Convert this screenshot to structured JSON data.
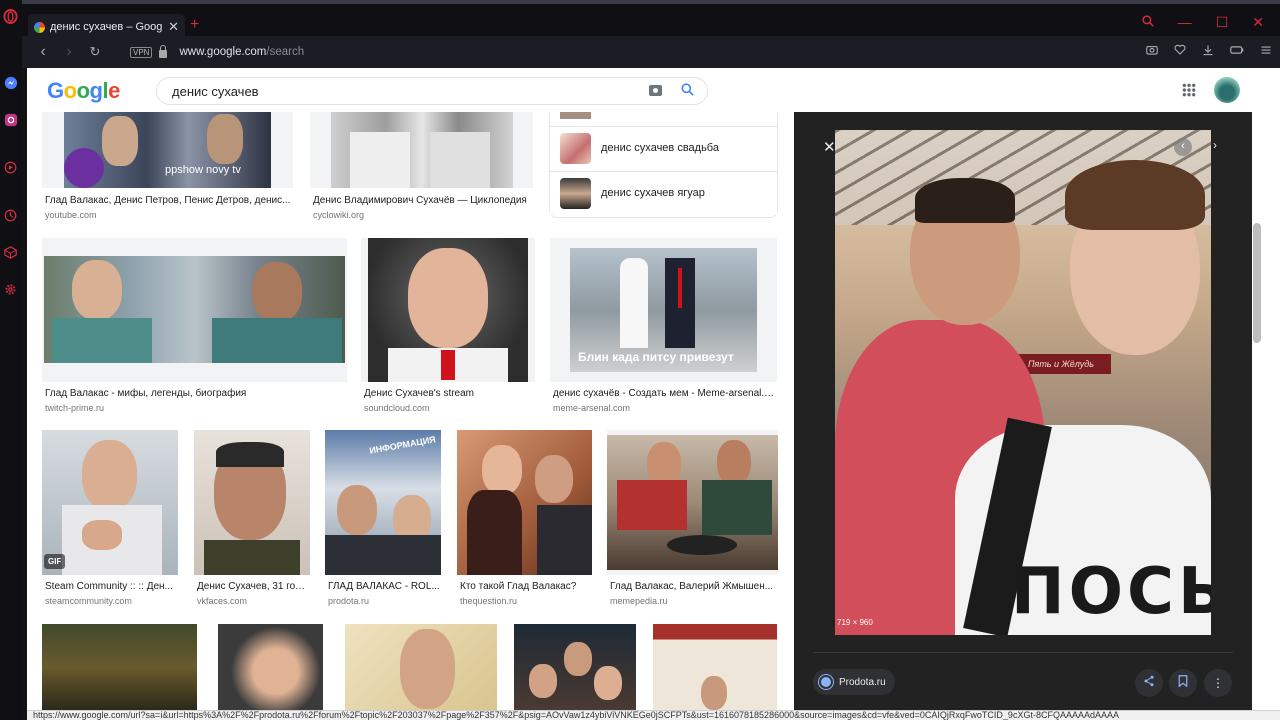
{
  "browser": {
    "tab_title": "денис сухачев – Google П",
    "vpn": "VPN",
    "url_host": "www.google.com",
    "url_path": "/search"
  },
  "search": {
    "query": "денис сухачев"
  },
  "related_searches": [
    {
      "label": "денис сухачев свадьба"
    },
    {
      "label": "денис сухачев ягуар"
    }
  ],
  "results_row1": [
    {
      "caption": "Глад Валакас, Денис Петров, Пенис Детров, денис...",
      "source": "youtube.com",
      "overlay": "ppshow novy tv"
    },
    {
      "caption": "Денис Владимирович Сухачёв — Циклопедия",
      "source": "cyclowiki.org"
    }
  ],
  "results_row2": [
    {
      "caption": "Глад Валакас - мифы, легенды, биография",
      "source": "twitch-prime.ru"
    },
    {
      "caption": "Денис Сухачев's stream",
      "source": "soundcloud.com"
    },
    {
      "caption": "денис сухачёв - Создать мем - Meme-arsenal.c...",
      "source": "meme-arsenal.com",
      "overlay": "Блин када питсу привезут"
    }
  ],
  "results_row3": [
    {
      "caption": "Steam Community :: :: Ден...",
      "source": "steamcommunity.com",
      "badge": "GIF"
    },
    {
      "caption": "Денис Сухачев, 31 год...",
      "source": "vkfaces.com"
    },
    {
      "caption": "ГЛАД ВАЛАКАС - ROL...",
      "source": "prodota.ru",
      "overlay": "ИНФОРМАЦИЯ"
    },
    {
      "caption": "Кто такой Глад Валакас?",
      "source": "thequestion.ru"
    },
    {
      "caption": "Глад Валакас, Валерий Жмышен...",
      "source": "memepedia.ru"
    }
  ],
  "preview": {
    "dimensions": "719 × 960",
    "source": "Prodota.ru",
    "shirt_text": "ПОСЫ",
    "sign_text": "Пять и Жёлудь"
  },
  "status_url": "https://www.google.com/url?sa=i&url=https%3A%2F%2Fprodota.ru%2Fforum%2Ftopic%2F203037%2Fpage%2F357%2F&psig=AOvVaw1z4ybiViVNKEGe0jSCFPTs&ust=1616078185286000&source=images&cd=vfe&ved=0CAIQjRxqFwoTCID_9cXGt-8CFQAAAAAdAAAA",
  "colors": {
    "opera_red": "#d62e3e",
    "google_blue": "#4285f4",
    "preview_bg": "#222222"
  }
}
